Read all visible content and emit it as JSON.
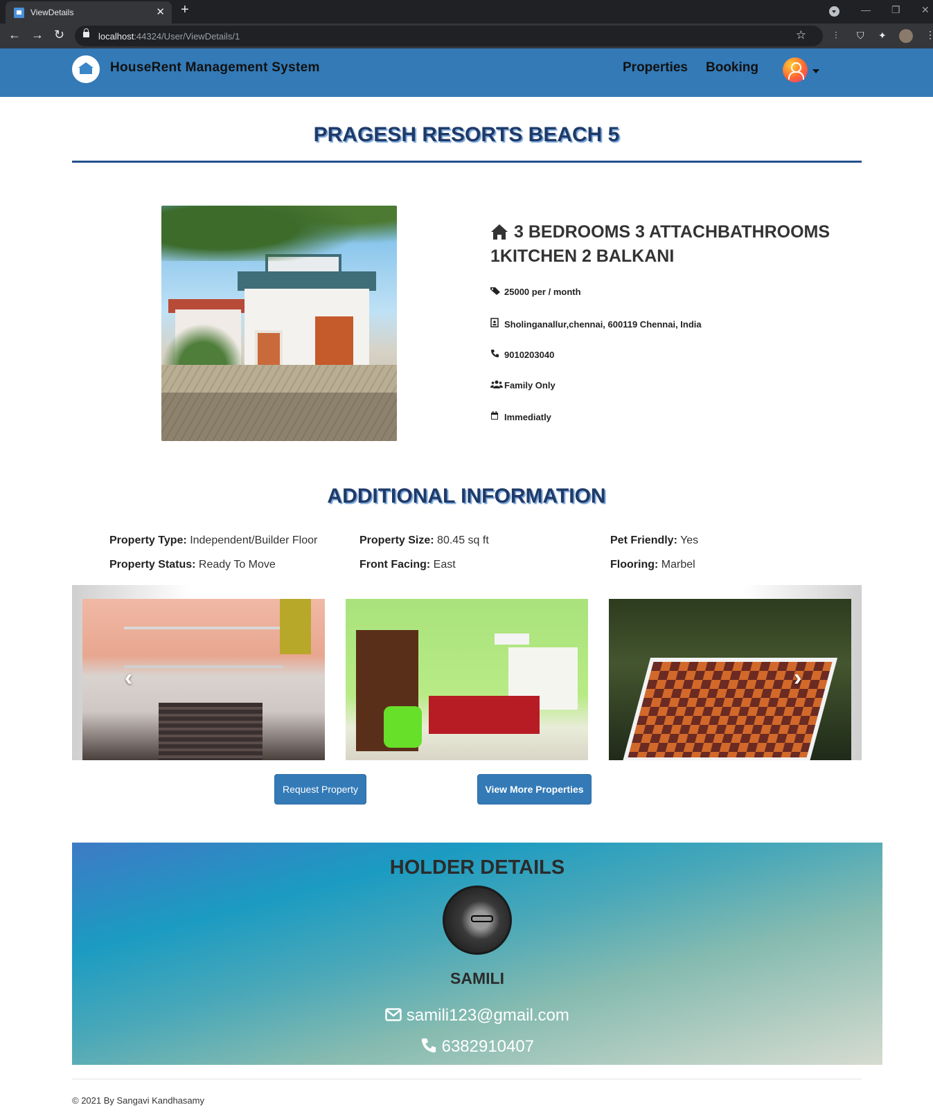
{
  "browser": {
    "tab_title": "ViewDetails",
    "tab_close": "✕",
    "new_tab": "+",
    "url_host": "localhost",
    "url_rest": ":44324/User/ViewDetails/1"
  },
  "navbar": {
    "brand": "HouseRent Management System",
    "links": [
      "Properties",
      "Booking"
    ]
  },
  "property": {
    "title": "PRAGESH RESORTS BEACH 5",
    "heading": "3 BEDROOMS 3 ATTACHBATHROOMS 1KITCHEN 2 BALKANI",
    "rent": "25000 per / month",
    "address": "Sholinganallur,chennai, 600119 Chennai, India",
    "phone": "9010203040",
    "tenant_type": "Family Only",
    "availability": "Immediatly"
  },
  "additional": {
    "title": "ADDITIONAL INFORMATION",
    "items": [
      {
        "label": "Property Type:",
        "value": "Independent/Builder Floor"
      },
      {
        "label": "Property Size:",
        "value": "80.45 sq ft"
      },
      {
        "label": "Pet Friendly:",
        "value": "Yes"
      },
      {
        "label": "Property Status:",
        "value": "Ready To Move"
      },
      {
        "label": "Front Facing:",
        "value": "East"
      },
      {
        "label": "Flooring:",
        "value": "Marbel"
      }
    ]
  },
  "carousel": {
    "prev": "‹",
    "next": "›"
  },
  "buttons": {
    "request": "Request Property",
    "view_more": "View More Properties"
  },
  "holder": {
    "title": "HOLDER DETAILS",
    "name": "SAMILI",
    "email": "samili123@gmail.com",
    "phone": "6382910407"
  },
  "footer": {
    "text": "© 2021 By Sangavi Kandhasamy"
  },
  "colors": {
    "navbar": "#337ab7",
    "title_text": "#1f3a68",
    "button": "#337ab7"
  },
  "icons": {
    "house": "home-icon",
    "rent": "tags-icon",
    "address": "address-card-icon",
    "phone": "phone-icon",
    "tenant": "users-icon",
    "availability": "calendar-icon",
    "email": "envelope-icon"
  }
}
